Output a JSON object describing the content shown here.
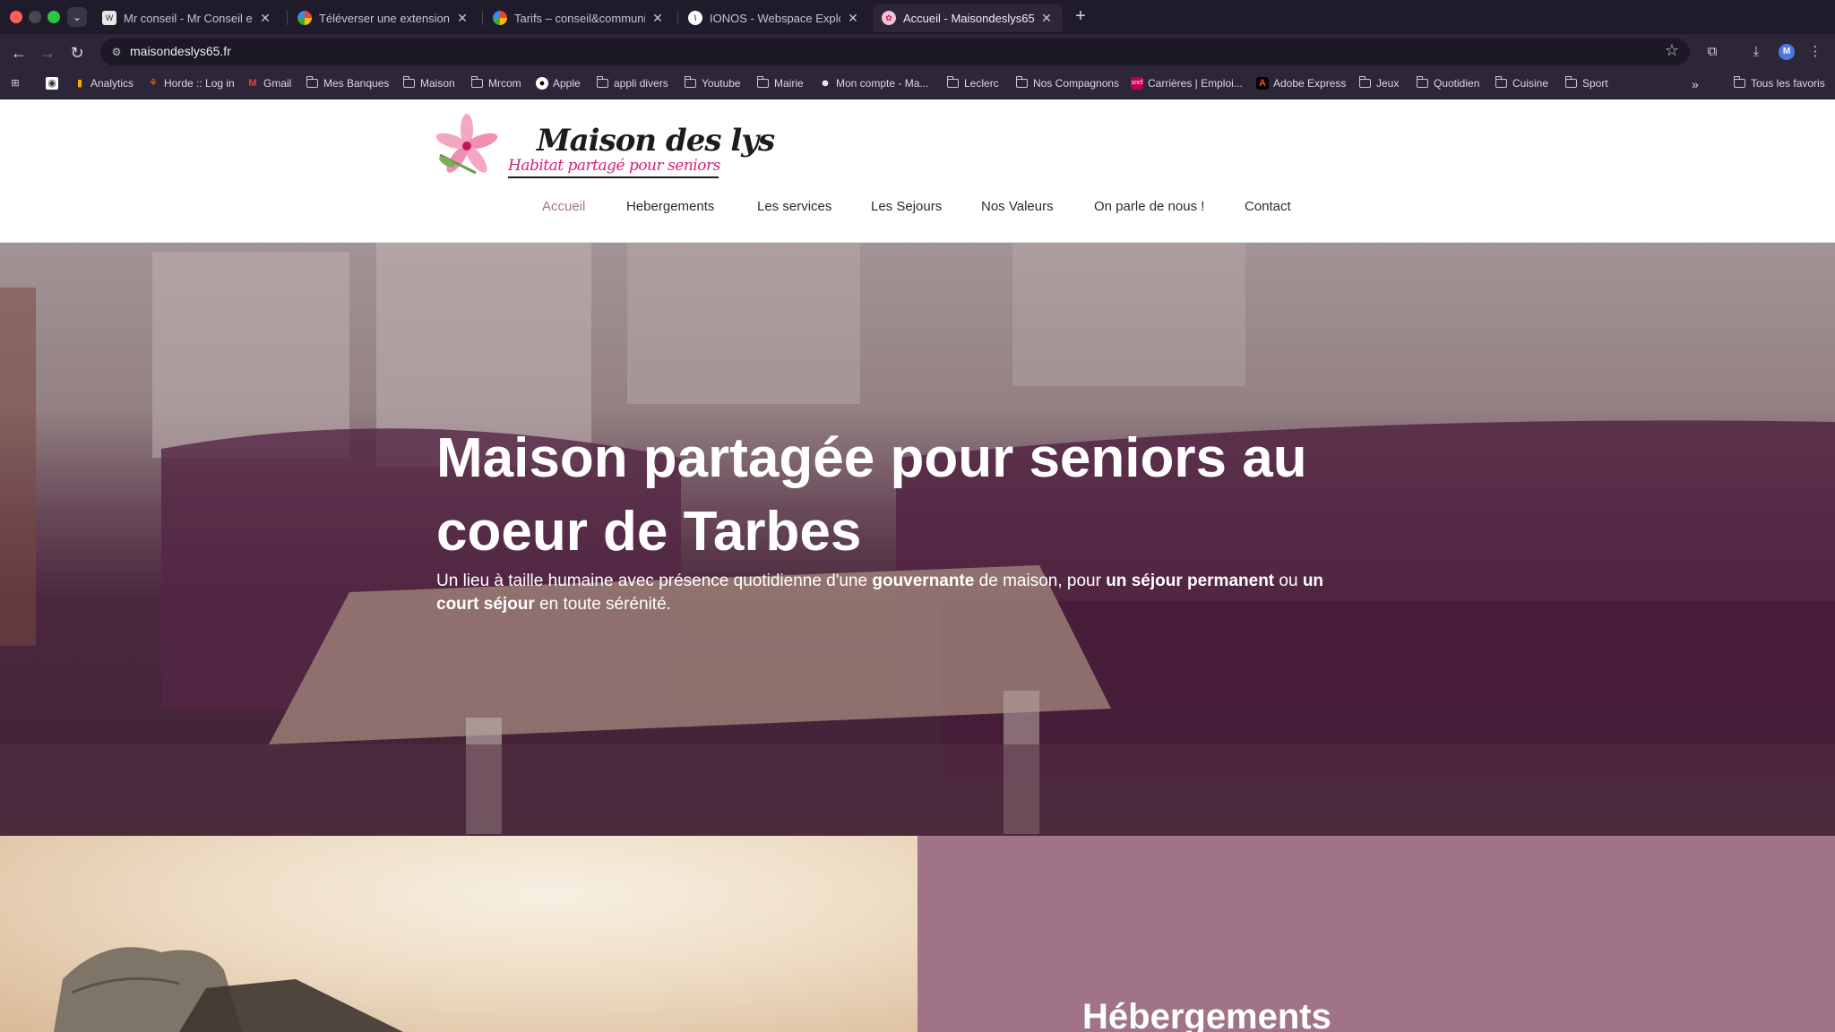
{
  "browser": {
    "tabs": [
      {
        "title": "Mr conseil - Mr Conseil et co",
        "active": false
      },
      {
        "title": "Téléverser une extension ‹ co",
        "active": false
      },
      {
        "title": "Tarifs – conseil&communicati",
        "active": false
      },
      {
        "title": "IONOS - Webspace Explorer",
        "active": false
      },
      {
        "title": "Accueil - Maisondeslys65",
        "active": true
      }
    ],
    "url": "maisondeslys65.fr",
    "profile_initial": "M",
    "bookmarks": [
      {
        "label": "Analytics",
        "icon": "analytics-icon"
      },
      {
        "label": "Horde :: Log in",
        "icon": "horde-icon"
      },
      {
        "label": "Gmail",
        "icon": "gmail-icon"
      },
      {
        "label": "Mes Banques",
        "icon": "folder-icon"
      },
      {
        "label": "Maison",
        "icon": "folder-icon"
      },
      {
        "label": "Mrcom",
        "icon": "folder-icon"
      },
      {
        "label": "Apple",
        "icon": "apple-icon"
      },
      {
        "label": "appli divers",
        "icon": "folder-icon"
      },
      {
        "label": "Youtube",
        "icon": "folder-icon"
      },
      {
        "label": "Mairie",
        "icon": "folder-icon"
      },
      {
        "label": "Mon compte - Ma...",
        "icon": "account-icon"
      },
      {
        "label": "Leclerc",
        "icon": "folder-icon"
      },
      {
        "label": "Nos Compagnons",
        "icon": "folder-icon"
      },
      {
        "label": "Carrières | Emploi...",
        "icon": "sncf-icon"
      },
      {
        "label": "Adobe Express",
        "icon": "adobe-icon"
      },
      {
        "label": "Jeux",
        "icon": "folder-icon"
      },
      {
        "label": "Quotidien",
        "icon": "folder-icon"
      },
      {
        "label": "Cuisine",
        "icon": "folder-icon"
      },
      {
        "label": "Sport",
        "icon": "folder-icon"
      }
    ],
    "all_bookmarks_label": "Tous les favoris"
  },
  "site": {
    "logo_title": "Maison des lys",
    "logo_subtitle": "Habitat partagé pour seniors",
    "nav": [
      {
        "label": "Accueil",
        "active": true
      },
      {
        "label": "Hebergements",
        "active": false
      },
      {
        "label": "Les services",
        "active": false
      },
      {
        "label": "Les Sejours",
        "active": false
      },
      {
        "label": "Nos Valeurs",
        "active": false
      },
      {
        "label": "On parle de nous !",
        "active": false
      },
      {
        "label": "Contact",
        "active": false
      }
    ],
    "hero": {
      "title": "Maison partagée pour seniors au coeur de Tarbes",
      "subtitle_parts": [
        {
          "text": "Un lieu à taille humaine avec présence quotidienne d'une ",
          "bold": false
        },
        {
          "text": "gouvernante",
          "bold": true
        },
        {
          "text": " de maison, pour ",
          "bold": false
        },
        {
          "text": "un séjour permanent",
          "bold": true
        },
        {
          "text": " ou ",
          "bold": false
        },
        {
          "text": "un court séjour",
          "bold": true
        },
        {
          "text": " en toute sérénité.",
          "bold": false
        }
      ]
    },
    "section_title": "Hébergements"
  },
  "colors": {
    "accent_mauve": "#a07486",
    "nav_active": "#a07888",
    "logo_pink": "#d3237a"
  }
}
